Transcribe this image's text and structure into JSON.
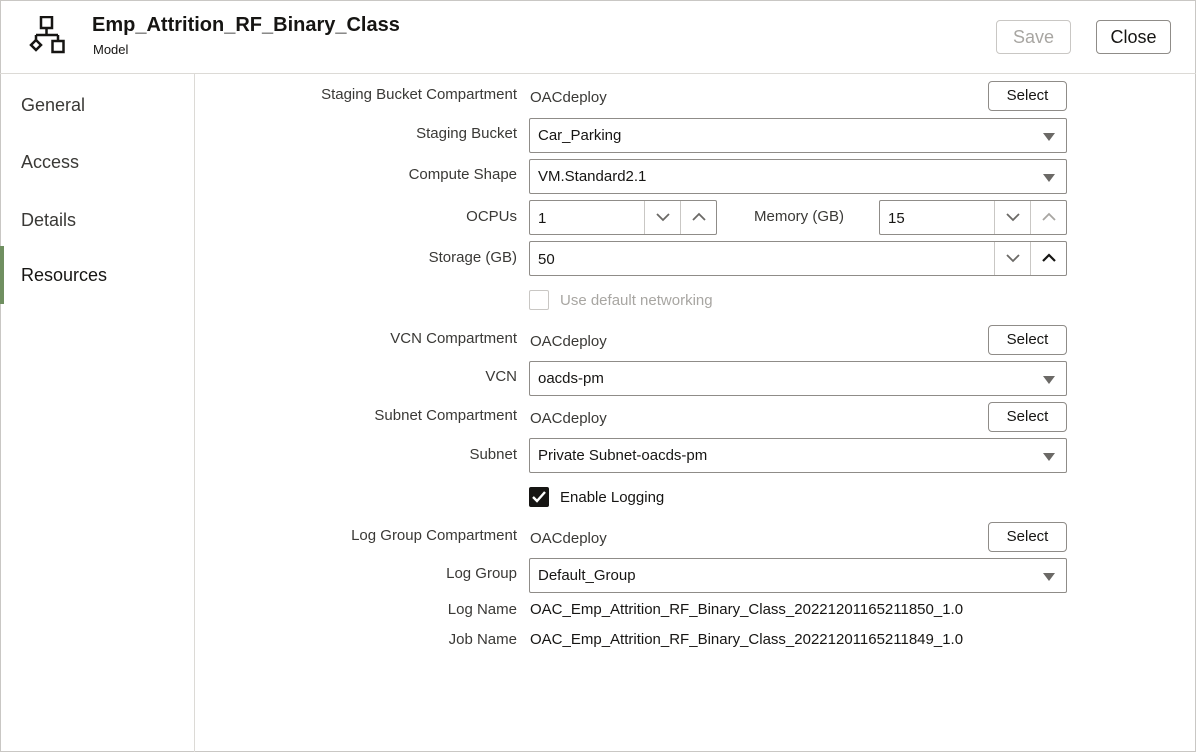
{
  "header": {
    "title": "Emp_Attrition_RF_Binary_Class",
    "subtitle": "Model",
    "icon": "model-hierarchy-icon",
    "save_label": "Save",
    "close_label": "Close"
  },
  "sidebar": {
    "items": [
      {
        "label": "General",
        "active": false
      },
      {
        "label": "Access",
        "active": false
      },
      {
        "label": "Details",
        "active": false
      },
      {
        "label": "Resources",
        "active": true
      }
    ]
  },
  "form": {
    "select_label": "Select",
    "staging_bucket_compartment": {
      "label": "Staging Bucket Compartment",
      "value": "OACdeploy"
    },
    "staging_bucket": {
      "label": "Staging Bucket",
      "value": "Car_Parking"
    },
    "compute_shape": {
      "label": "Compute Shape",
      "value": "VM.Standard2.1"
    },
    "ocpus": {
      "label": "OCPUs",
      "value": "1"
    },
    "memory": {
      "label": "Memory (GB)",
      "value": "15"
    },
    "storage": {
      "label": "Storage (GB)",
      "value": "50"
    },
    "default_networking": {
      "label": "Use default networking",
      "checked": false,
      "disabled": true
    },
    "vcn_compartment": {
      "label": "VCN Compartment",
      "value": "OACdeploy"
    },
    "vcn": {
      "label": "VCN",
      "value": "oacds-pm"
    },
    "subnet_compartment": {
      "label": "Subnet Compartment",
      "value": "OACdeploy"
    },
    "subnet": {
      "label": "Subnet",
      "value": "Private Subnet-oacds-pm"
    },
    "enable_logging": {
      "label": "Enable Logging",
      "checked": true
    },
    "log_group_compartment": {
      "label": "Log Group Compartment",
      "value": "OACdeploy"
    },
    "log_group": {
      "label": "Log Group",
      "value": "Default_Group"
    },
    "log_name": {
      "label": "Log Name",
      "value": "OAC_Emp_Attrition_RF_Binary_Class_20221201165211850_1.0"
    },
    "job_name": {
      "label": "Job Name",
      "value": "OAC_Emp_Attrition_RF_Binary_Class_20221201165211849_1.0"
    }
  },
  "colors": {
    "active_nav_accent": "#6f8f60",
    "checkbox_checked": "#161513"
  }
}
